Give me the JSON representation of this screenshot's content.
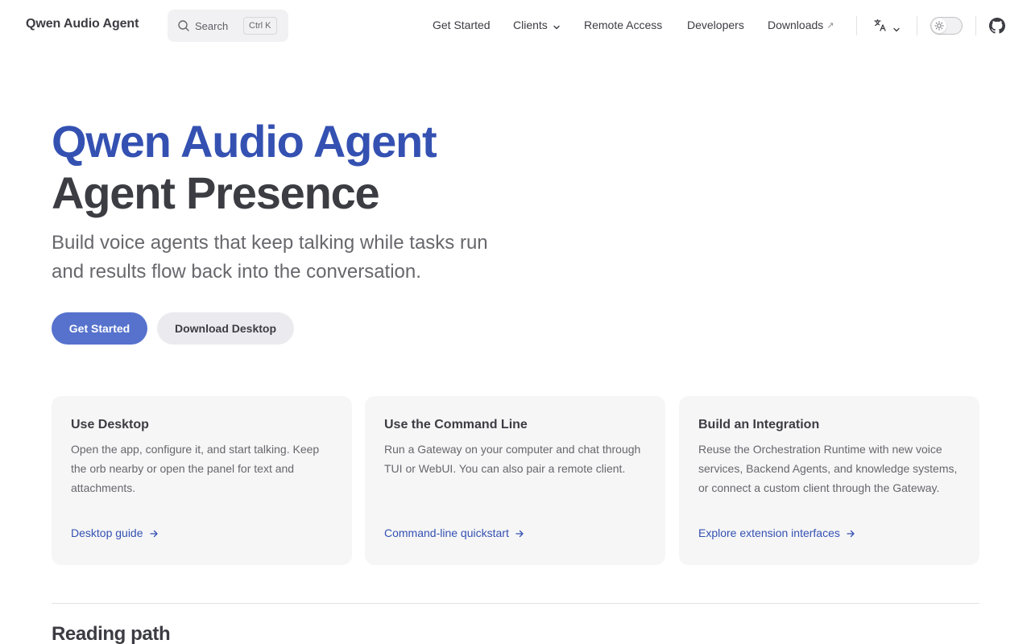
{
  "nav": {
    "brand": "Qwen Audio Agent",
    "search_label": "Search",
    "search_shortcut": "Ctrl K",
    "links": {
      "get_started": "Get Started",
      "clients": "Clients",
      "remote_access": "Remote Access",
      "developers": "Developers",
      "downloads": "Downloads",
      "downloads_ext_glyph": "↗"
    },
    "icons": [
      "search-icon",
      "chevron-down-icon",
      "external-link-icon",
      "translate-icon",
      "sun-icon",
      "github-icon"
    ]
  },
  "hero": {
    "name": "Qwen Audio Agent",
    "text": "Agent Presence",
    "tagline": "Build voice agents that keep talking while tasks run and results flow back into the conversation.",
    "actions": {
      "primary": "Get Started",
      "secondary": "Download Desktop"
    }
  },
  "features": [
    {
      "title": "Use Desktop",
      "details": "Open the app, configure it, and start talking. Keep the orb nearby or open the panel for text and attachments.",
      "link": "Desktop guide"
    },
    {
      "title": "Use the Command Line",
      "details": "Run a Gateway on your computer and chat through TUI or WebUI. You can also pair a remote client.",
      "link": "Command-line quickstart"
    },
    {
      "title": "Build an Integration",
      "details": "Reuse the Orchestration Runtime with new voice services, Backend Agents, and knowledge systems, or connect a custom client through the Gateway.",
      "link": "Explore extension interfaces"
    }
  ],
  "reading_path": {
    "title": "Reading path"
  },
  "colors": {
    "brand": "#3451b2",
    "button_primary": "#5672cd",
    "text": "#3c3c43",
    "muted": "#67676c",
    "card_bg": "#f6f6f7"
  }
}
